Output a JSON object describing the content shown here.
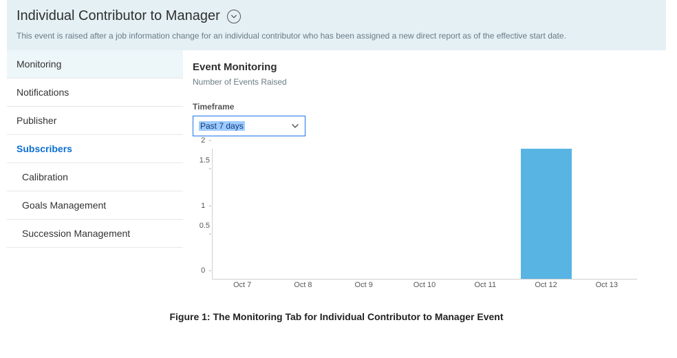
{
  "header": {
    "title": "Individual Contributor to Manager",
    "subtitle": "This event is raised after a job information change for an individual contributor who has been assigned a new direct report as of the effective start date."
  },
  "sidebar": {
    "items": [
      {
        "label": "Monitoring",
        "selected": true,
        "indent": false,
        "highlight": false
      },
      {
        "label": "Notifications",
        "selected": false,
        "indent": false,
        "highlight": false
      },
      {
        "label": "Publisher",
        "selected": false,
        "indent": false,
        "highlight": false
      },
      {
        "label": "Subscribers",
        "selected": false,
        "indent": false,
        "highlight": true
      },
      {
        "label": "Calibration",
        "selected": false,
        "indent": true,
        "highlight": false
      },
      {
        "label": "Goals Management",
        "selected": false,
        "indent": true,
        "highlight": false
      },
      {
        "label": "Succession Management",
        "selected": false,
        "indent": true,
        "highlight": false
      }
    ]
  },
  "main": {
    "section_title": "Event Monitoring",
    "section_sub": "Number of Events Raised",
    "timeframe_label": "Timeframe",
    "timeframe_value": "Past 7 days"
  },
  "chart_data": {
    "type": "bar",
    "categories": [
      "Oct 7",
      "Oct 8",
      "Oct 9",
      "Oct 10",
      "Oct 11",
      "Oct 12",
      "Oct 13"
    ],
    "values": [
      0,
      0,
      0,
      0,
      0,
      2,
      0
    ],
    "ylabel": "",
    "xlabel": "",
    "title": "",
    "ylim": [
      0,
      2
    ],
    "yticks": [
      0,
      0.5,
      1,
      1.5,
      2
    ]
  },
  "caption": "Figure 1: The Monitoring Tab for Individual Contributor to Manager Event",
  "colors": {
    "bar": "#58b4e3",
    "header_bg": "#e4f0f4",
    "accent": "#0a6ed1"
  }
}
